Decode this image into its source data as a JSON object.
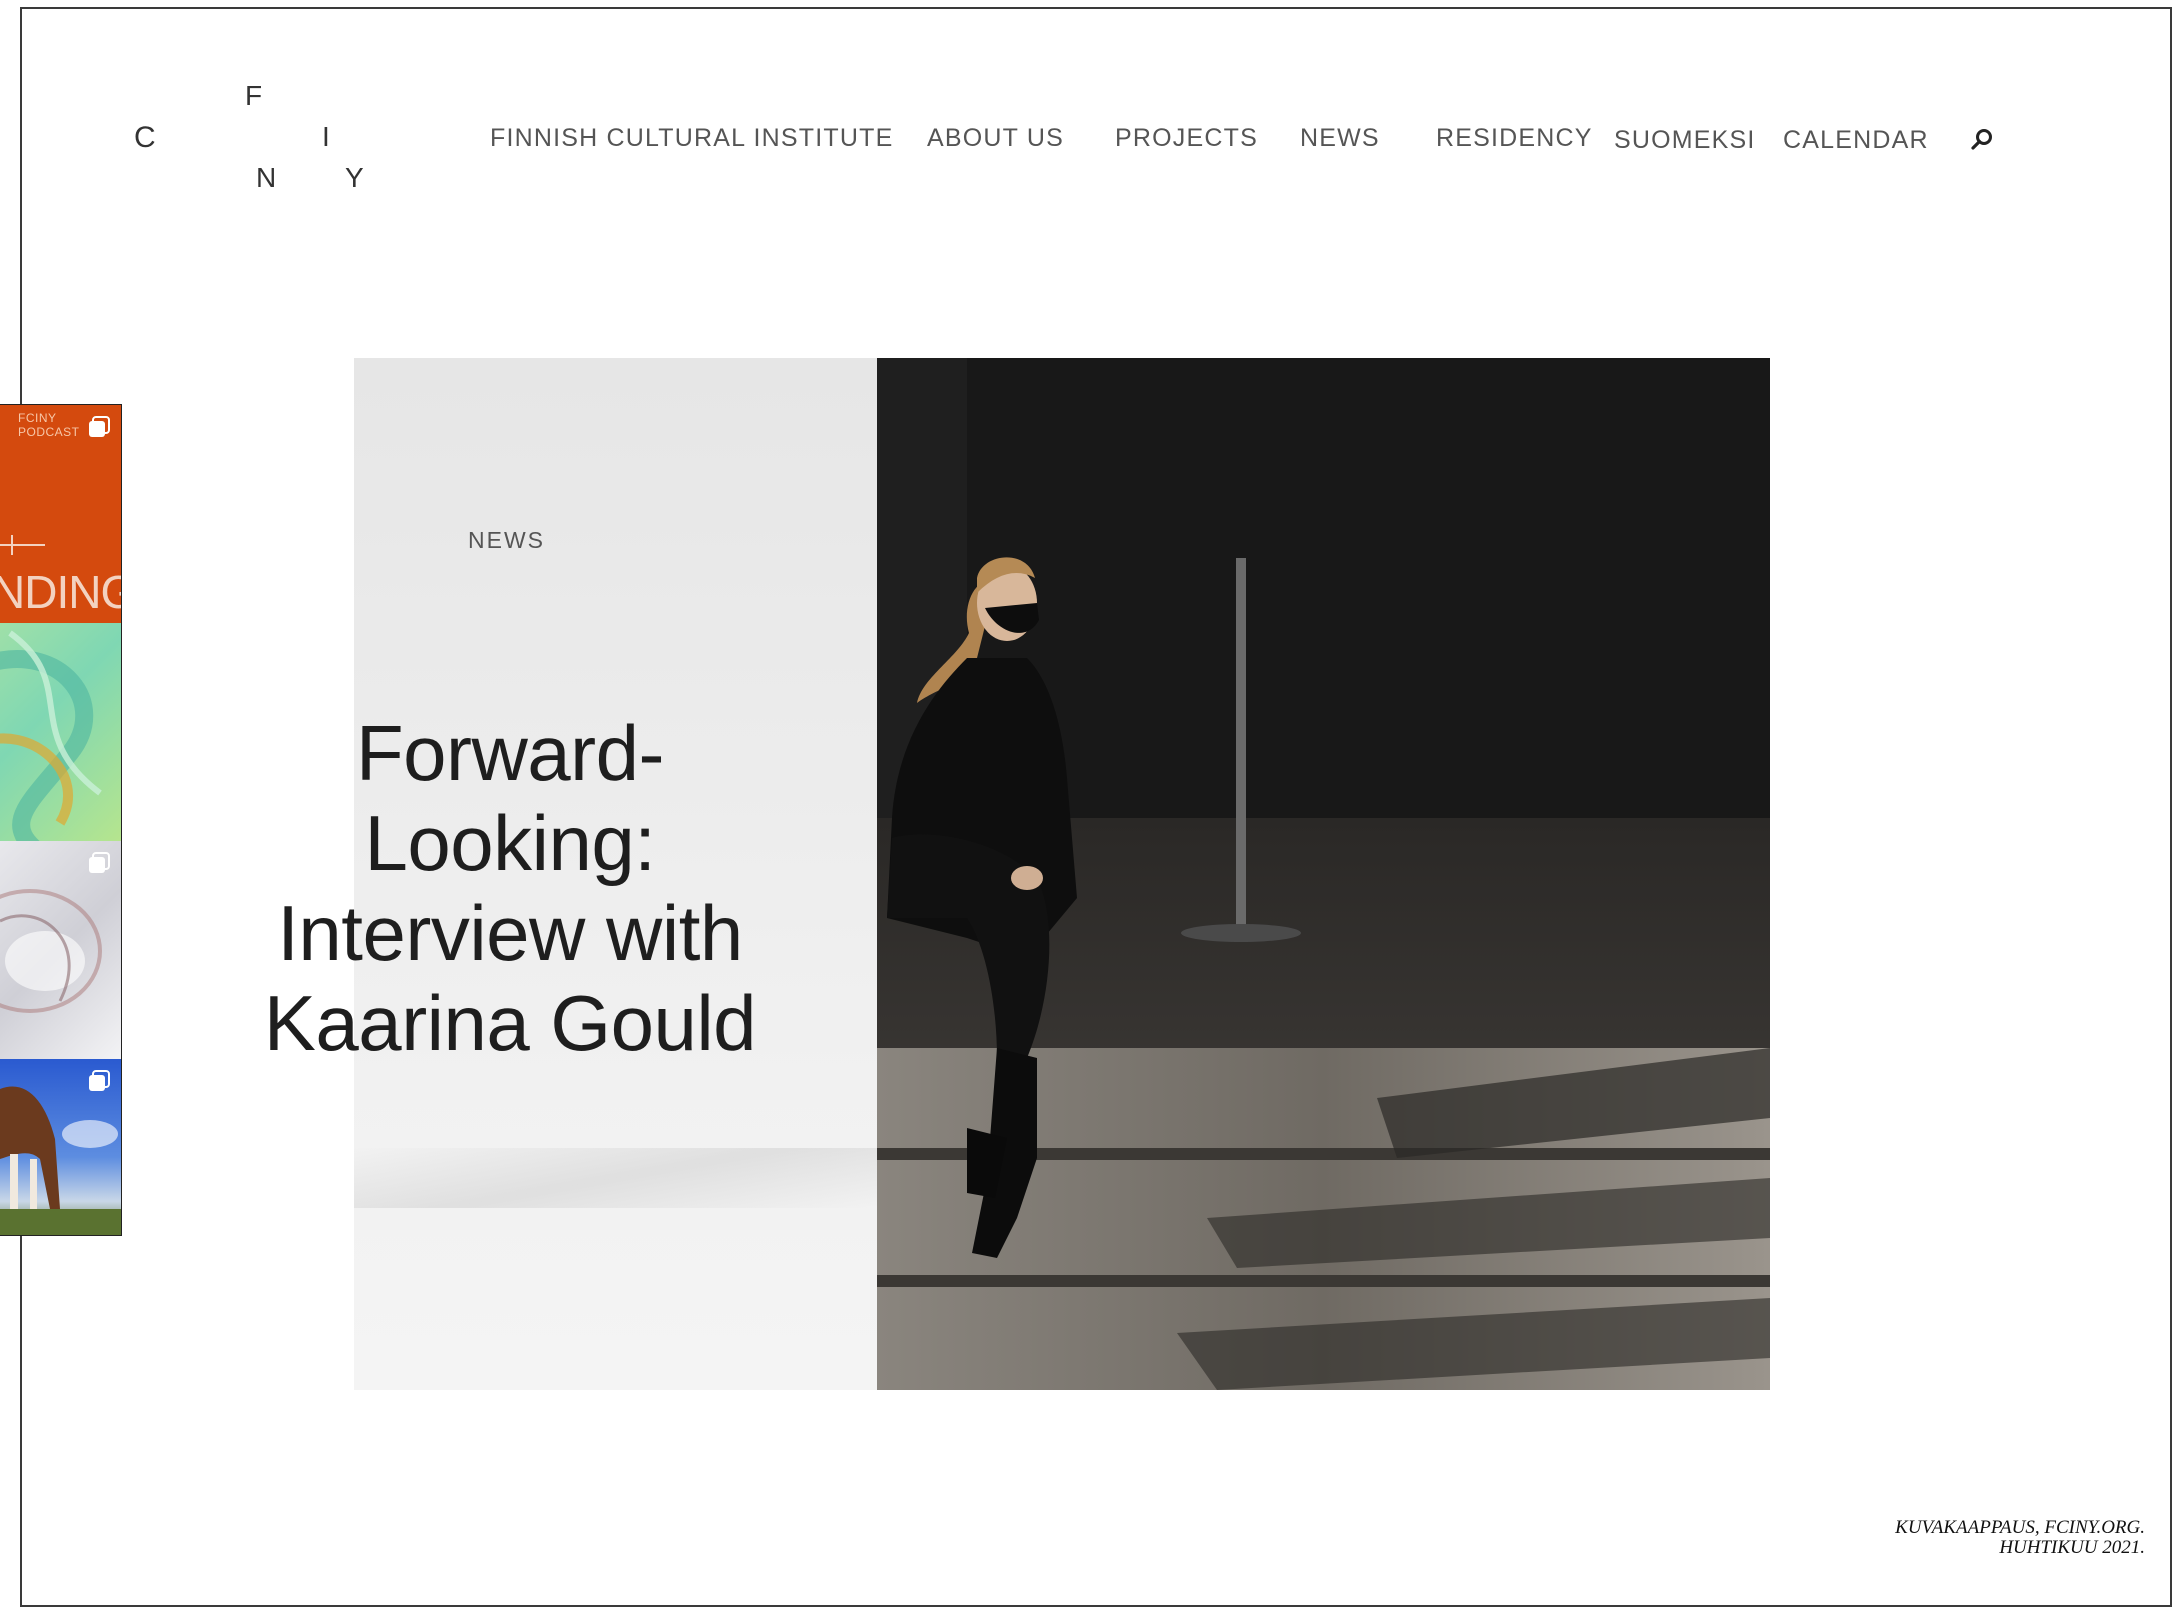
{
  "logo": {
    "letters": [
      "C",
      "F",
      "I",
      "N",
      "Y"
    ]
  },
  "nav": {
    "items": [
      {
        "label": "FINNISH CULTURAL INSTITUTE"
      },
      {
        "label": "ABOUT US"
      },
      {
        "label": "PROJECTS"
      },
      {
        "label": "NEWS"
      },
      {
        "label": "RESIDENCY"
      },
      {
        "label": "SUOMEKSI"
      },
      {
        "label": "CALENDAR"
      }
    ],
    "search_icon": "search-icon"
  },
  "hero": {
    "section_label": "NEWS",
    "headline_lines": [
      "Forward-",
      "Looking:",
      "Interview with",
      "Kaarina Gould"
    ]
  },
  "instagram_strip": {
    "tile1_caption": "FCINY PODCAST",
    "tile1_word": "NDING",
    "tile_icon": "multiple-images-icon"
  },
  "credit": {
    "line1": "KUVAKAAPPAUS, FCINY.ORG.",
    "line2": "HUHTIKUU 2021."
  },
  "colors": {
    "text": "#2a2a2a",
    "nav_text": "#555555",
    "hero_left_bg": "#ececec",
    "tile_orange": "#d44a0e"
  }
}
